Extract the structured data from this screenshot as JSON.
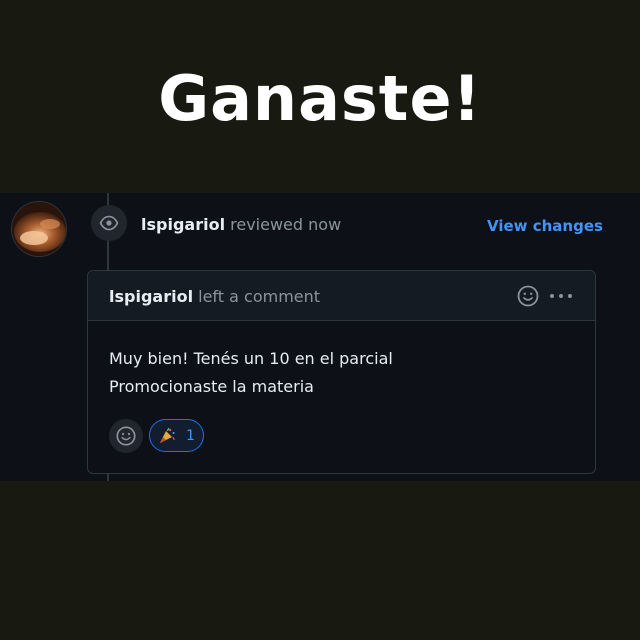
{
  "headline": "Ganaste!",
  "review": {
    "username": "lspigariol",
    "action": "reviewed now",
    "view_changes_label": "View changes"
  },
  "comment": {
    "username": "lspigariol",
    "action": "left a comment",
    "body_lines": [
      "Muy bien! Tenés un 10 en el parcial",
      "Promocionaste la materia"
    ],
    "reactions": [
      {
        "emoji_name": "party-popper-icon",
        "count": "1"
      }
    ]
  },
  "colors": {
    "page_bg": "#181911",
    "github_bg": "#0d1117",
    "link_blue": "#4493f8",
    "border": "#30363d"
  }
}
